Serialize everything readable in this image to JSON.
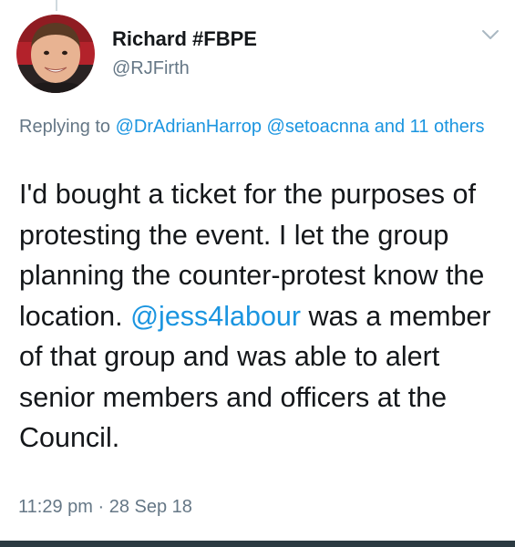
{
  "author": {
    "display_name": "Richard #FBPE",
    "handle": "@RJFirth"
  },
  "reply": {
    "prefix": "Replying to",
    "mention_1": "@DrAdrianHarrop",
    "mention_2": "@setoacnna",
    "and_others": "and 11 others"
  },
  "tweet": {
    "text_before_mention": "I'd bought a ticket for the purposes of protesting the event. I let the group planning the counter-protest know the location.",
    "mention": "@jess4labour",
    "text_after_mention": "was a member of that group and was able to alert senior members and officers at the Council."
  },
  "meta": {
    "time": "11:29 pm",
    "separator": "·",
    "date": "28 Sep 18"
  },
  "icons": {
    "avatar": "profile-photo",
    "menu": "chevron-down-icon"
  },
  "colors": {
    "link": "#1b95e0",
    "secondary_text": "#657786",
    "primary_text": "#14171a"
  }
}
